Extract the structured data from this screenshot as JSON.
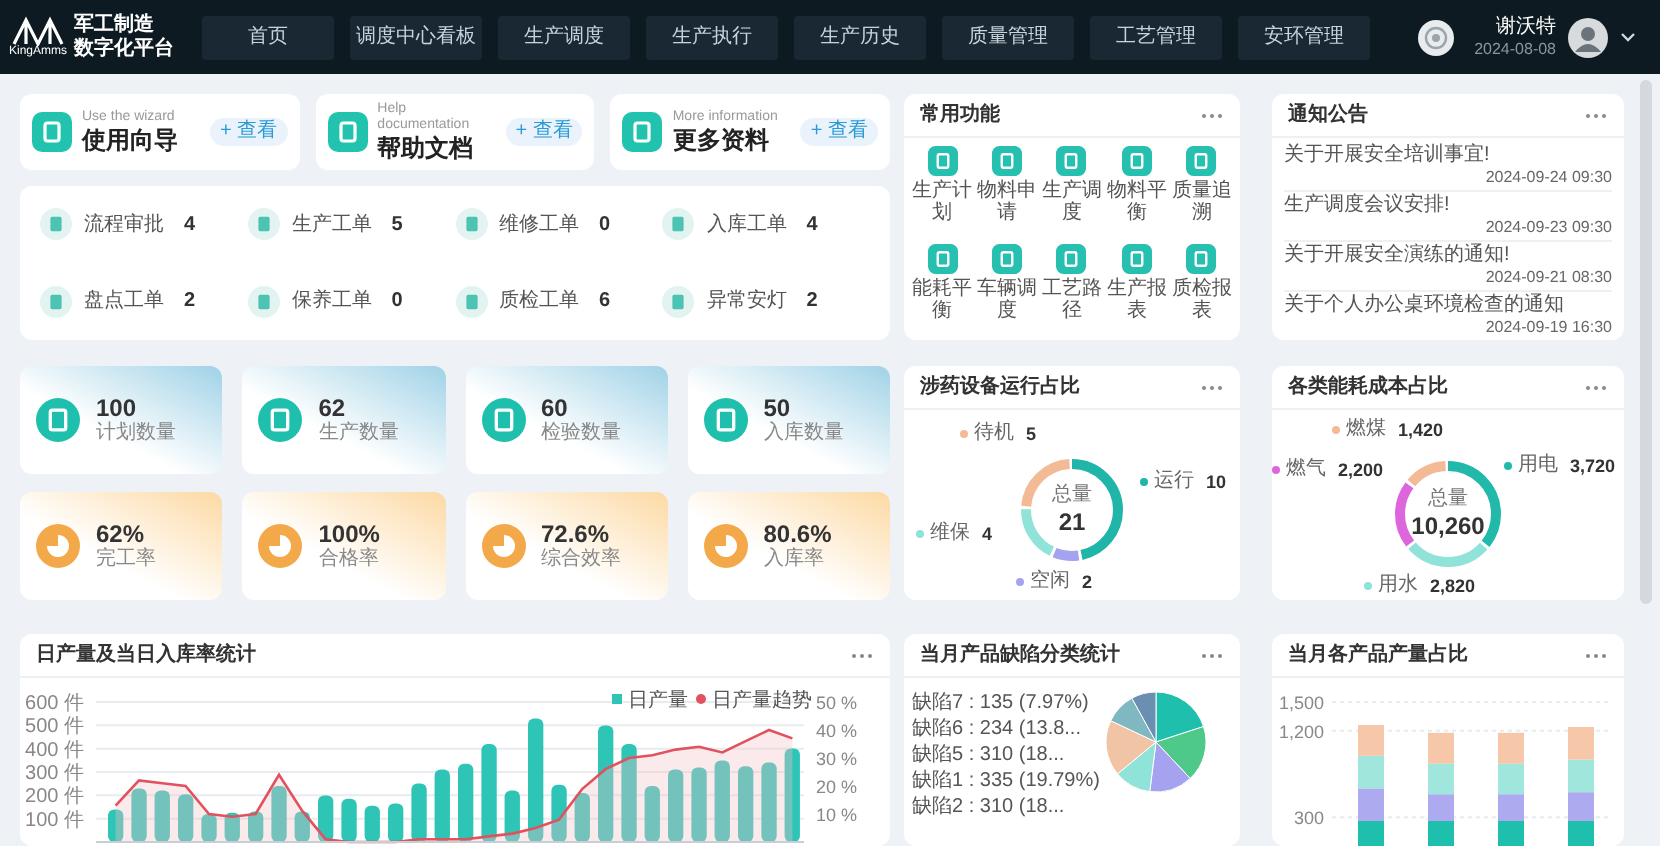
{
  "header": {
    "logo_text": "KingAmms",
    "title_lines": [
      "军工制造",
      "数字化平台"
    ],
    "nav": [
      "首页",
      "调度中心看板",
      "生产调度",
      "生产执行",
      "生产历史",
      "质量管理",
      "工艺管理",
      "安环管理"
    ],
    "user": {
      "name": "谢沃特",
      "date": "2024-08-08"
    }
  },
  "quick_links": [
    {
      "subtitle": "Use the wizard",
      "title": "使用向导",
      "button": "+ 查看"
    },
    {
      "subtitle": "Help documentation",
      "title": "帮助文档",
      "button": "+ 查看"
    },
    {
      "subtitle": "More information",
      "title": "更多资料",
      "button": "+ 查看"
    }
  ],
  "work_orders": [
    {
      "label": "流程审批",
      "count": "4"
    },
    {
      "label": "生产工单",
      "count": "5"
    },
    {
      "label": "维修工单",
      "count": "0"
    },
    {
      "label": "入库工单",
      "count": "4"
    },
    {
      "label": "盘点工单",
      "count": "2"
    },
    {
      "label": "保养工单",
      "count": "0"
    },
    {
      "label": "质检工单",
      "count": "6"
    },
    {
      "label": "异常安灯",
      "count": "2"
    }
  ],
  "common_functions": {
    "title": "常用功能",
    "items": [
      "生产计划",
      "物料申请",
      "生产调度",
      "物料平衡",
      "质量追溯",
      "能耗平衡",
      "车辆调度",
      "工艺路径",
      "生产报表",
      "质检报表"
    ]
  },
  "notices": {
    "title": "通知公告",
    "items": [
      {
        "text": "关于开展安全培训事宜!",
        "time": "2024-09-24 09:30"
      },
      {
        "text": "生产调度会议安排!",
        "time": "2024-09-23 09:30"
      },
      {
        "text": "关于开展安全演练的通知!",
        "time": "2024-09-21 08:30"
      },
      {
        "text": "关于个人办公桌环境检查的通知",
        "time": "2024-09-19 16:30"
      }
    ]
  },
  "stats": [
    {
      "kind": "count",
      "value": "100",
      "label": "计划数量"
    },
    {
      "kind": "count",
      "value": "62",
      "label": "生产数量"
    },
    {
      "kind": "count",
      "value": "60",
      "label": "检验数量"
    },
    {
      "kind": "count",
      "value": "50",
      "label": "入库数量"
    },
    {
      "kind": "rate",
      "value": "62%",
      "label": "完工率"
    },
    {
      "kind": "rate",
      "value": "100%",
      "label": "合格率"
    },
    {
      "kind": "rate",
      "value": "72.6%",
      "label": "综合效率"
    },
    {
      "kind": "rate",
      "value": "80.6%",
      "label": "入库率"
    }
  ],
  "device_chart": {
    "title": "涉药设备运行占比",
    "center_label": "总量",
    "center_value": "21",
    "legend": [
      {
        "name": "运行",
        "value": "10",
        "color": "#1fb5a8"
      },
      {
        "name": "空闲",
        "value": "2",
        "color": "#a5a3f0"
      },
      {
        "name": "维保",
        "value": "4",
        "color": "#8fe3d8"
      },
      {
        "name": "待机",
        "value": "5",
        "color": "#f4b995"
      }
    ]
  },
  "energy_chart": {
    "title": "各类能耗成本占比",
    "center_label": "总量",
    "center_value": "10,260",
    "legend": [
      {
        "name": "用电",
        "value": "3,720",
        "color": "#20b9aa"
      },
      {
        "name": "用水",
        "value": "2,820",
        "color": "#8fe3d8"
      },
      {
        "name": "燃气",
        "value": "2,200",
        "color": "#dd66dd"
      },
      {
        "name": "燃煤",
        "value": "1,420",
        "color": "#f4b995"
      }
    ]
  },
  "daily_chart": {
    "title": "日产量及当日入库率统计",
    "bars": {
      "chart_data": {
        "type": "bar",
        "grid": true,
        "ylim": [
          0,
          600
        ],
        "yticks": [
          {
            "value": 600,
            "label": "600 件"
          },
          {
            "value": 500,
            "label": "500 件"
          },
          {
            "value": 400,
            "label": "400 件"
          },
          {
            "value": 300,
            "label": "300 件"
          },
          {
            "value": 200,
            "label": "200 件"
          },
          {
            "value": 100,
            "label": "100 件"
          }
        ],
        "series": [
          {
            "name": "日产量",
            "color": "#2ec4b6",
            "values": [
              140,
              230,
              220,
              205,
              120,
              125,
              130,
              240,
              130,
              200,
              185,
              155,
              165,
              250,
              310,
              335,
              420,
              220,
              530,
              245,
              210,
              500,
              420,
              240,
              310,
              320,
              350,
              325,
              340,
              400
            ]
          }
        ]
      }
    },
    "trend": {
      "chart_data": {
        "type": "line",
        "ylim": [
          0,
          50
        ],
        "yticks": [
          {
            "value": 50,
            "label": "50 %"
          },
          {
            "value": 40,
            "label": "40 %"
          },
          {
            "value": 30,
            "label": "30 %"
          },
          {
            "value": 20,
            "label": "20 %"
          },
          {
            "value": 10,
            "label": "10 %"
          }
        ],
        "series": [
          {
            "name": "日产量趋势",
            "color": "#e0525e",
            "values": [
              13,
              22,
              21,
              20,
              10,
              9,
              10,
              24,
              11,
              1,
              0,
              0,
              0,
              1,
              1,
              1,
              2,
              3,
              5,
              8,
              19,
              26,
              30,
              31,
              33,
              34,
              32,
              36,
              40,
              37
            ]
          }
        ]
      }
    }
  },
  "defect_chart": {
    "title": "当月产品缺陷分类统计",
    "labels": [
      "缺陷7 : 135 (7.97%)",
      "缺陷6 : 234 (13.8...",
      "缺陷5 : 310 (18...",
      "缺陷1 : 335 (19.79%)",
      "缺陷2 : 310 (18..."
    ]
  },
  "product_chart": {
    "title": "当月各产品产量占比",
    "chart_data": {
      "type": "bar",
      "stacked": true,
      "grid": true,
      "ylim": [
        0,
        1500
      ],
      "yticks": [
        {
          "value": 1500,
          "label": "1,500"
        },
        {
          "value": 1200,
          "label": "1,200"
        },
        {
          "value": 300,
          "label": "300"
        }
      ],
      "series": [
        {
          "color": "#1fbfae",
          "values": [
            260,
            260,
            260,
            260
          ]
        },
        {
          "color": "#aeaaf0",
          "values": [
            340,
            280,
            280,
            300
          ]
        },
        {
          "color": "#a0e6dc",
          "values": [
            340,
            320,
            320,
            340
          ]
        },
        {
          "color": "#f6c7a8",
          "values": [
            320,
            320,
            320,
            340
          ]
        }
      ]
    }
  }
}
